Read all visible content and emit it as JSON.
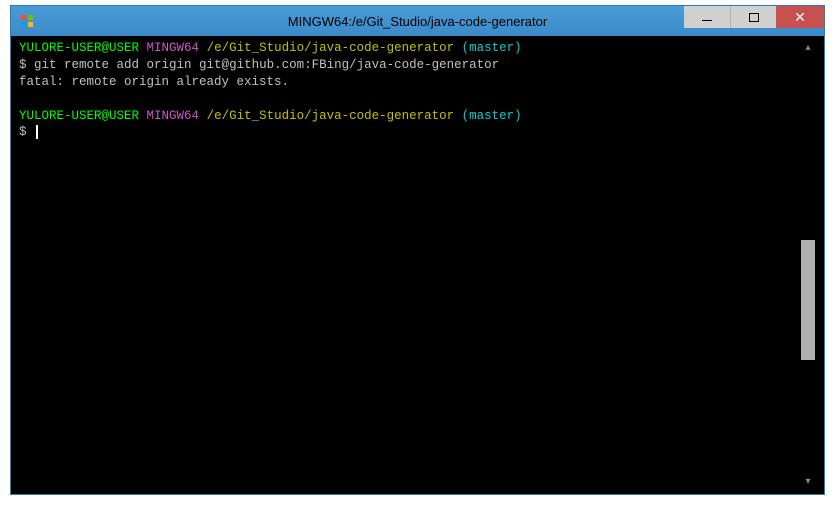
{
  "window": {
    "title": "MINGW64:/e/Git_Studio/java-code-generator"
  },
  "terminal": {
    "line1": {
      "user": "YULORE-USER@USER",
      "host": "MINGW64",
      "path": "/e/Git_Studio/java-code-generator",
      "branch": "(master)"
    },
    "line2": {
      "dollar": "$",
      "command": "git remote add origin git@github.com:FBing/java-code-generator"
    },
    "line3": {
      "output": "fatal: remote origin already exists."
    },
    "line4": {
      "user": "YULORE-USER@USER",
      "host": "MINGW64",
      "path": "/e/Git_Studio/java-code-generator",
      "branch": "(master)"
    },
    "line5": {
      "dollar": "$"
    }
  }
}
